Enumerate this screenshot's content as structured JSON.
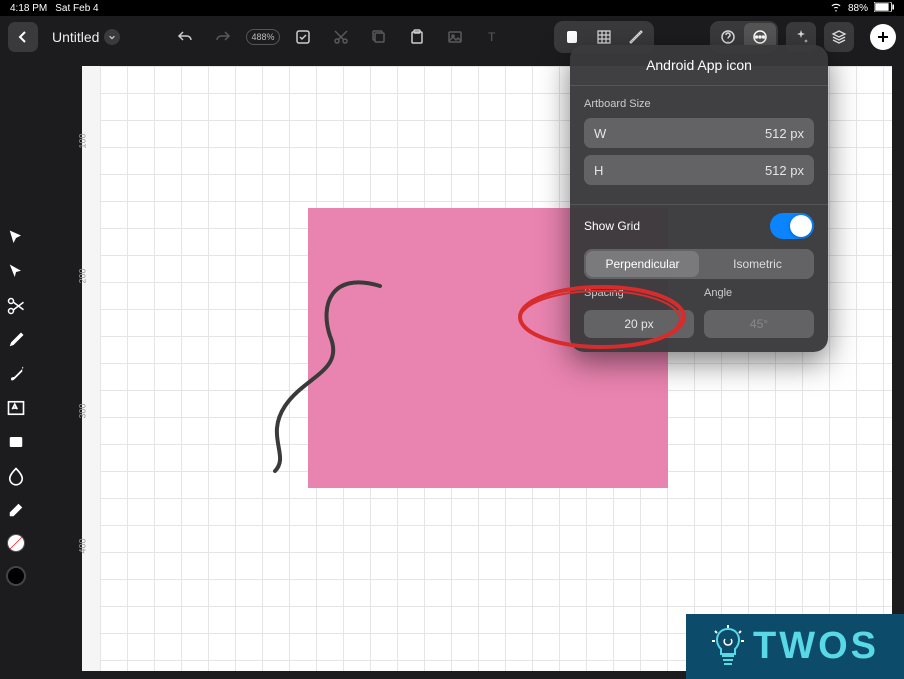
{
  "status_bar": {
    "time": "4:18 PM",
    "date": "Sat Feb 4",
    "battery": "88%"
  },
  "header": {
    "title": "Untitled",
    "zoom": "488%"
  },
  "ruler": {
    "100": "100",
    "200": "200",
    "300": "300",
    "400": "400"
  },
  "popover": {
    "title": "Android App icon",
    "section1_label": "Artboard Size",
    "width_label": "W",
    "width_value": "512 px",
    "height_label": "H",
    "height_value": "512 px",
    "show_grid_label": "Show Grid",
    "show_grid_on": true,
    "seg_perpendicular": "Perpendicular",
    "seg_isometric": "Isometric",
    "spacing_label": "Spacing",
    "spacing_value": "20 px",
    "angle_label": "Angle",
    "angle_value": "45°"
  },
  "watermark": {
    "text": "TWOS"
  },
  "icons": {
    "back": "back-icon",
    "undo": "undo-icon",
    "redo": "redo-icon",
    "check": "check-icon",
    "cut": "cut-icon",
    "copy": "copy-icon",
    "paste": "paste-icon",
    "photo": "photo-icon",
    "text": "text-icon",
    "stack": "stack-icon",
    "grid": "grid-icon",
    "ruler": "ruler-icon",
    "help": "help-icon",
    "settings": "settings-icon",
    "export": "export-icon",
    "layers": "layers-icon",
    "plus": "plus-icon"
  }
}
